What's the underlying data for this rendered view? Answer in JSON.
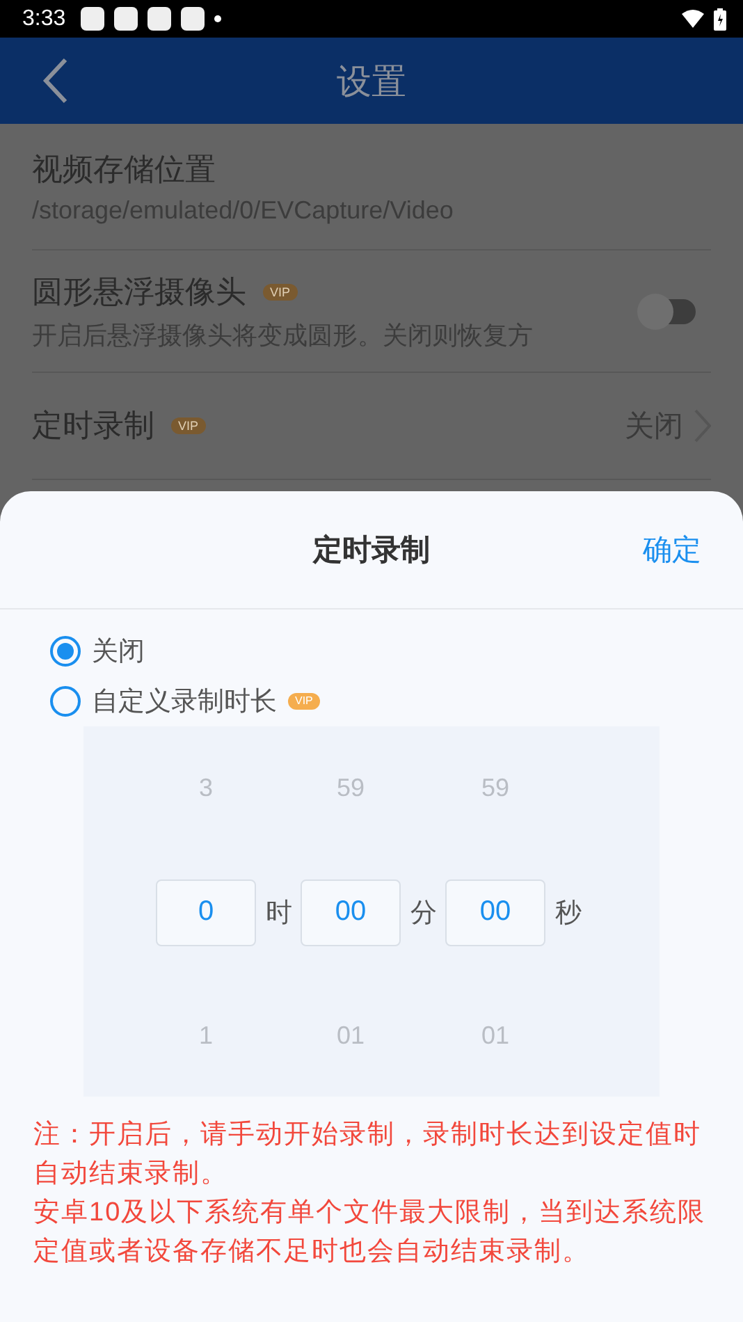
{
  "status_bar": {
    "time": "3:33"
  },
  "app_bar": {
    "title": "设置"
  },
  "settings": [
    {
      "kind": "path",
      "title": "视频存储位置",
      "value": "/storage/emulated/0/EVCapture/Video"
    },
    {
      "kind": "toggle",
      "title": "圆形悬浮摄像头",
      "badge": "VIP",
      "description": "开启后悬浮摄像头将变成圆形。关闭则恢复方",
      "on": false
    },
    {
      "kind": "nav",
      "title": "定时录制",
      "badge": "VIP",
      "value": "关闭"
    }
  ],
  "sheet": {
    "title": "定时录制",
    "confirm": "确定",
    "options": [
      {
        "label": "关闭",
        "selected": true
      },
      {
        "label": "自定义录制时长",
        "badge": "VIP",
        "selected": false
      }
    ],
    "picker": [
      {
        "above": "3",
        "value": "0",
        "below": "1",
        "unit": "时"
      },
      {
        "above": "59",
        "value": "00",
        "below": "01",
        "unit": "分"
      },
      {
        "above": "59",
        "value": "00",
        "below": "01",
        "unit": "秒"
      }
    ],
    "notes": [
      "注：开启后，请手动开始录制，录制时长达到设定值时自动结束录制。",
      "安卓10及以下系统有单个文件最大限制，当到达系统限定值或者设备存储不足时也会自动结束录制。"
    ]
  }
}
